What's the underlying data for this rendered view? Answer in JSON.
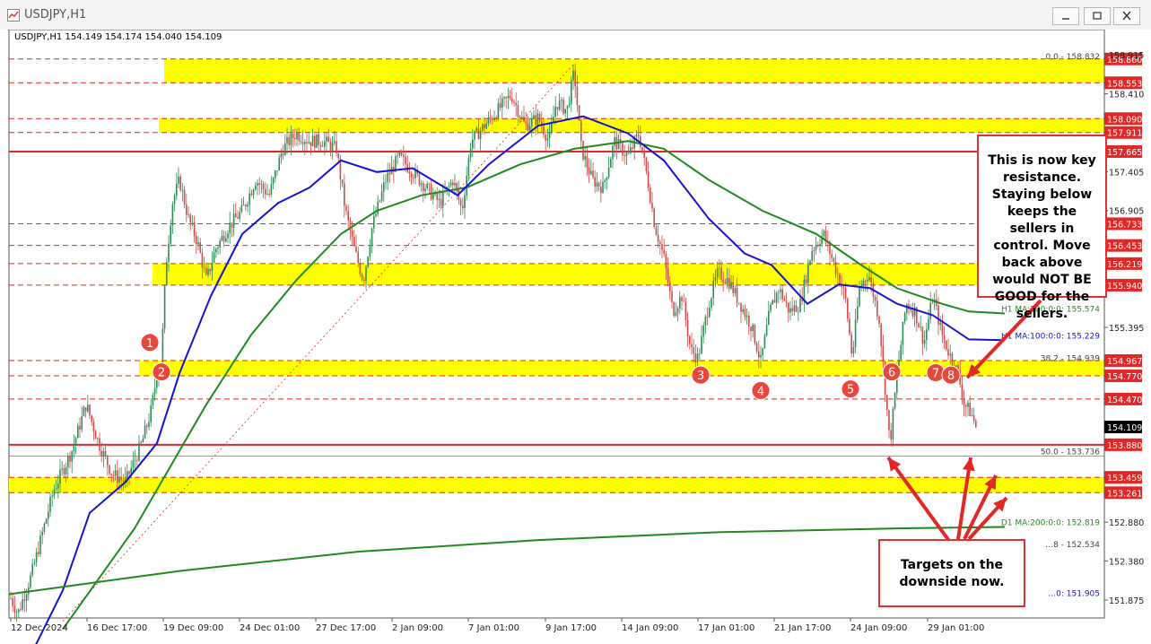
{
  "window": {
    "title": "USDJPY,H1",
    "buttons": [
      "minimize",
      "restore",
      "close"
    ]
  },
  "chart_data": {
    "type": "candlestick",
    "symbol": "USDJPY",
    "timeframe": "H1",
    "header": "USDJPY,H1  154.149 154.174 154.040 154.109",
    "ylim": [
      151.6,
      159.02
    ],
    "yaxis_ticks": [
      "158.915",
      "158.410",
      "157.405",
      "156.905",
      "155.395",
      "152.880",
      "152.380",
      "151.875"
    ],
    "xaxis_ticks": [
      "12 Dec 2024",
      "16 Dec 17:00",
      "19 Dec 09:00",
      "24 Dec 01:00",
      "27 Dec 17:00",
      "2 Jan 09:00",
      "7 Jan 01:00",
      "9 Jan 17:00",
      "14 Jan 09:00",
      "17 Jan 01:00",
      "21 Jan 17:00",
      "24 Jan 09:00",
      "29 Jan 01:00"
    ],
    "price_path": [
      [
        0,
        152.2
      ],
      [
        8,
        152.0
      ],
      [
        20,
        151.7
      ],
      [
        35,
        152.2
      ],
      [
        60,
        153.3
      ],
      [
        80,
        153.8
      ],
      [
        96,
        154.4
      ],
      [
        110,
        153.9
      ],
      [
        125,
        153.5
      ],
      [
        140,
        153.4
      ],
      [
        158,
        153.9
      ],
      [
        168,
        154.3
      ],
      [
        175,
        154.8
      ],
      [
        180,
        155.0
      ],
      [
        185,
        156.2
      ],
      [
        192,
        157.0
      ],
      [
        200,
        157.3
      ],
      [
        210,
        156.8
      ],
      [
        220,
        156.5
      ],
      [
        230,
        156.0
      ],
      [
        240,
        156.4
      ],
      [
        255,
        156.7
      ],
      [
        270,
        156.9
      ],
      [
        285,
        157.3
      ],
      [
        300,
        157.1
      ],
      [
        315,
        157.7
      ],
      [
        330,
        157.9
      ],
      [
        345,
        157.8
      ],
      [
        360,
        157.8
      ],
      [
        375,
        157.7
      ],
      [
        385,
        156.9
      ],
      [
        395,
        156.4
      ],
      [
        405,
        156.0
      ],
      [
        415,
        156.7
      ],
      [
        430,
        157.3
      ],
      [
        445,
        157.6
      ],
      [
        460,
        157.4
      ],
      [
        475,
        157.2
      ],
      [
        490,
        157.0
      ],
      [
        505,
        157.3
      ],
      [
        515,
        156.9
      ],
      [
        525,
        157.8
      ],
      [
        540,
        158.0
      ],
      [
        555,
        158.2
      ],
      [
        570,
        158.4
      ],
      [
        585,
        158.0
      ],
      [
        600,
        158.1
      ],
      [
        612,
        157.8
      ],
      [
        620,
        158.3
      ],
      [
        632,
        158.2
      ],
      [
        640,
        158.7
      ],
      [
        648,
        157.7
      ],
      [
        660,
        157.3
      ],
      [
        672,
        157.2
      ],
      [
        685,
        157.8
      ],
      [
        700,
        157.6
      ],
      [
        712,
        157.9
      ],
      [
        722,
        157.3
      ],
      [
        730,
        156.7
      ],
      [
        740,
        156.3
      ],
      [
        750,
        155.6
      ],
      [
        760,
        155.8
      ],
      [
        770,
        155.1
      ],
      [
        778,
        155.0
      ],
      [
        790,
        155.7
      ],
      [
        800,
        156.1
      ],
      [
        812,
        156.0
      ],
      [
        825,
        155.7
      ],
      [
        838,
        155.4
      ],
      [
        848,
        154.95
      ],
      [
        858,
        155.6
      ],
      [
        868,
        155.9
      ],
      [
        880,
        155.6
      ],
      [
        892,
        155.7
      ],
      [
        905,
        156.4
      ],
      [
        918,
        156.6
      ],
      [
        930,
        156.2
      ],
      [
        942,
        155.8
      ],
      [
        950,
        155.0
      ],
      [
        958,
        155.9
      ],
      [
        968,
        156.1
      ],
      [
        980,
        155.5
      ],
      [
        992,
        153.88
      ],
      [
        1000,
        154.8
      ],
      [
        1010,
        155.7
      ],
      [
        1020,
        155.6
      ],
      [
        1030,
        155.2
      ],
      [
        1040,
        155.8
      ],
      [
        1050,
        155.3
      ],
      [
        1060,
        155.0
      ],
      [
        1068,
        154.8
      ],
      [
        1075,
        154.4
      ],
      [
        1082,
        154.3
      ],
      [
        1088,
        154.109
      ]
    ],
    "moving_averages": [
      {
        "name": "H1 MA:200:0:0",
        "value": 155.574,
        "label": "H1 MA:200:0:0: 155.574",
        "color": "#1f8b1f",
        "path": [
          [
            70,
            151.5
          ],
          [
            150,
            152.8
          ],
          [
            190,
            153.6
          ],
          [
            230,
            154.4
          ],
          [
            280,
            155.3
          ],
          [
            330,
            156.0
          ],
          [
            380,
            156.6
          ],
          [
            420,
            156.9
          ],
          [
            470,
            157.1
          ],
          [
            520,
            157.2
          ],
          [
            580,
            157.5
          ],
          [
            640,
            157.7
          ],
          [
            700,
            157.8
          ],
          [
            740,
            157.7
          ],
          [
            790,
            157.3
          ],
          [
            850,
            156.9
          ],
          [
            910,
            156.6
          ],
          [
            960,
            156.2
          ],
          [
            1000,
            155.9
          ],
          [
            1050,
            155.7
          ],
          [
            1080,
            155.6
          ],
          [
            1120,
            155.574
          ]
        ]
      },
      {
        "name": "H1 MA:100:0:0",
        "value": 155.229,
        "label": "H1 MA:100:0:0: 155.229",
        "color": "#1414d2",
        "path": [
          [
            40,
            151.3
          ],
          [
            70,
            152.0
          ],
          [
            100,
            153.0
          ],
          [
            140,
            153.4
          ],
          [
            175,
            153.9
          ],
          [
            200,
            154.8
          ],
          [
            235,
            155.8
          ],
          [
            270,
            156.6
          ],
          [
            310,
            157.0
          ],
          [
            345,
            157.2
          ],
          [
            380,
            157.55
          ],
          [
            420,
            157.4
          ],
          [
            460,
            157.45
          ],
          [
            510,
            157.1
          ],
          [
            545,
            157.5
          ],
          [
            600,
            158.0
          ],
          [
            650,
            158.12
          ],
          [
            700,
            157.9
          ],
          [
            740,
            157.55
          ],
          [
            790,
            156.8
          ],
          [
            830,
            156.35
          ],
          [
            860,
            156.2
          ],
          [
            900,
            155.7
          ],
          [
            935,
            155.95
          ],
          [
            970,
            155.9
          ],
          [
            1000,
            155.7
          ],
          [
            1040,
            155.55
          ],
          [
            1080,
            155.24
          ],
          [
            1120,
            155.229
          ]
        ]
      },
      {
        "name": "D1 MA:200:0:0",
        "value": 152.819,
        "label": "D1 MA:200:0:0: 152.819",
        "color": "#1f8b1f",
        "path": [
          [
            10,
            151.95
          ],
          [
            200,
            152.25
          ],
          [
            400,
            152.5
          ],
          [
            600,
            152.65
          ],
          [
            800,
            152.75
          ],
          [
            1000,
            152.8
          ],
          [
            1120,
            152.819
          ]
        ]
      }
    ],
    "horizontal_lines": [
      {
        "price": 158.86,
        "label": "158.860",
        "style": "dashed"
      },
      {
        "price": 158.553,
        "label": "158.553",
        "style": "dashed"
      },
      {
        "price": 158.09,
        "label": "158.090",
        "style": "dashed"
      },
      {
        "price": 157.911,
        "label": "157.911",
        "style": "dashed"
      },
      {
        "price": 157.665,
        "label": "157.665",
        "style": "solid"
      },
      {
        "price": 156.733,
        "label": "156.733",
        "style": "dashed"
      },
      {
        "price": 156.453,
        "label": "156.453",
        "style": "dashed"
      },
      {
        "price": 156.219,
        "label": "156.219",
        "style": "dashed"
      },
      {
        "price": 155.94,
        "label": "155.940",
        "style": "dashed"
      },
      {
        "price": 154.967,
        "label": "154.967",
        "style": "dashed"
      },
      {
        "price": 154.77,
        "label": "154.770",
        "style": "dashed"
      },
      {
        "price": 154.47,
        "label": "154.470",
        "style": "dashed"
      },
      {
        "price": 153.88,
        "label": "153.880",
        "style": "solid"
      },
      {
        "price": 153.459,
        "label": "153.459",
        "style": "dashed"
      },
      {
        "price": 153.261,
        "label": "153.261",
        "style": "dashed"
      }
    ],
    "zones": [
      {
        "from": 158.553,
        "to": 158.86,
        "x_start": 183
      },
      {
        "from": 157.911,
        "to": 158.09,
        "x_start": 177
      },
      {
        "from": 155.94,
        "to": 156.219,
        "x_start": 170
      },
      {
        "from": 154.77,
        "to": 154.967,
        "x_start": 155
      },
      {
        "from": 153.261,
        "to": 153.459,
        "x_start": 10
      }
    ],
    "fibonacci": [
      {
        "price": 158.832,
        "label": "0.0 - 158.832"
      },
      {
        "price": 154.939,
        "label": "38.2 - 154.939"
      },
      {
        "price": 153.736,
        "label": "50.0 - 153.736"
      },
      {
        "price": 152.534,
        "label": "…8 - 152.534"
      },
      {
        "price": 151.905,
        "label": "…0: 151.905"
      }
    ],
    "current_price": "154.109",
    "markers": [
      {
        "label": "1",
        "x": 167,
        "price": 155.2
      },
      {
        "label": "2",
        "x": 180,
        "price": 154.82
      },
      {
        "label": "3",
        "x": 781,
        "price": 154.78
      },
      {
        "label": "4",
        "x": 848,
        "price": 154.58
      },
      {
        "label": "5",
        "x": 948,
        "price": 154.6
      },
      {
        "label": "6",
        "x": 994,
        "price": 154.82
      },
      {
        "label": "7",
        "x": 1043,
        "price": 154.81
      },
      {
        "label": "8",
        "x": 1060,
        "price": 154.78
      }
    ],
    "annotations": [
      {
        "text": "This is now key resistance. Staying below keeps the sellers in control.  Move back above would NOT BE GOOD for the sellers."
      },
      {
        "text": "Targets on the downside now."
      }
    ]
  }
}
